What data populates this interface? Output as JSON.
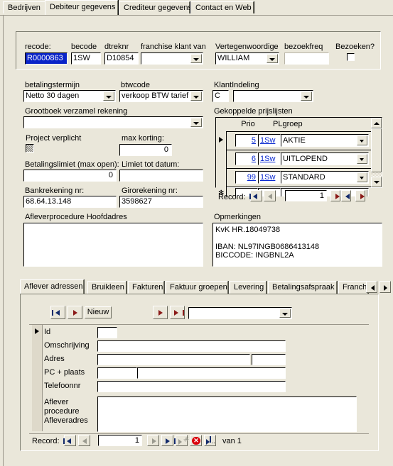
{
  "window": {
    "title": "Debiteur gegevens",
    "main_tabs": [
      {
        "label": "Bedrijven",
        "active": false
      },
      {
        "label": "Debiteur gegevens",
        "active": true
      },
      {
        "label": "Crediteur gegevens",
        "active": false
      },
      {
        "label": "Contact en Web",
        "active": false
      }
    ]
  },
  "header_fields": {
    "recode_label": "recode:",
    "recode_value": "R0000863",
    "becode_label": "becode",
    "becode_value": "1SW",
    "dtreknr_label": "dtreknr",
    "dtreknr_value": "D10854",
    "franchise_label": "franchise klant van",
    "franchise_value": "",
    "vertegenwoordige_label": "Vertegenwoordige",
    "vertegenwoordige_value": "WILLIAM",
    "bezoekfreq_label": "bezoekfreq",
    "bezoekfreq_value": "",
    "bezoeken_label": "Bezoeken?",
    "bezoeken_checked": false
  },
  "left_column": {
    "betalingstermijn_label": "betalingstermijn",
    "betalingstermijn_value": "Netto 30 dagen",
    "btwcode_label": "btwcode",
    "btwcode_value": "verkoop BTW tarief",
    "grootboek_label": "Grootboek verzamel rekening",
    "grootboek_value": "",
    "project_verplicht_label": "Project verplicht",
    "max_korting_label": "max korting:",
    "max_korting_value": "0",
    "betalingslimiet_label": "Betalingslimiet (max open):",
    "betalingslimiet_value": "0",
    "limiet_tot_datum_label": "Limiet tot datum:",
    "limiet_tot_datum_value": "",
    "bankrekening_label": "Bankrekening nr:",
    "bankrekening_value": "68.64.13.148",
    "girorekening_label": "Girorekening nr:",
    "girorekening_value": "3598627",
    "afleverprocedure_label": "Afleverprocedure Hoofdadres",
    "afleverprocedure_value": ""
  },
  "right_column": {
    "klantindeling_label": "KlantIndeling",
    "klantindeling_code": "C",
    "klantindeling_value": "",
    "prijslijsten_label": "Gekoppelde prijslijsten",
    "opmerkingen_label": "Opmerkingen",
    "opmerkingen_value": "KvK HR.18049738\n\nIBAN: NL97INGB0686413148\nBICCODE: INGBNL2A"
  },
  "prijslijsten_grid": {
    "columns": [
      "Prio",
      "PLgroep"
    ],
    "rows": [
      {
        "prio": "5",
        "code": "1Sw",
        "plgroep": "AKTIE",
        "selected": true
      },
      {
        "prio": "6",
        "code": "1Sw",
        "plgroep": "UITLOPEND",
        "selected": false
      },
      {
        "prio": "99",
        "code": "1Sw",
        "plgroep": "STANDARD",
        "selected": false
      }
    ],
    "nav": {
      "record_label": "Record:",
      "current": "1"
    }
  },
  "sub_tabs": [
    {
      "label": "Aflever adressen",
      "active": true
    },
    {
      "label": "Bruikleen",
      "active": false
    },
    {
      "label": "Fakturen",
      "active": false
    },
    {
      "label": "Faktuur groepen",
      "active": false
    },
    {
      "label": "Levering",
      "active": false
    },
    {
      "label": "Betalingsafspraak",
      "active": false
    },
    {
      "label": "Franchis",
      "active": false
    }
  ],
  "subform": {
    "toolbar": {
      "new_label": "Nieuw",
      "selector_value": ""
    },
    "fields": [
      {
        "label": "Id",
        "value": ""
      },
      {
        "label": "Omschrijving",
        "value": ""
      },
      {
        "label": "Adres",
        "value": "",
        "value2": ""
      },
      {
        "label": "PC + plaats",
        "value": "",
        "value2": ""
      },
      {
        "label": "Telefoonnr",
        "value": ""
      }
    ],
    "memo_label": "Aflever\nprocedure\nAfleveradres",
    "memo_value": "",
    "nav": {
      "record_label": "Record:",
      "current": "1",
      "of_label": "van  1"
    }
  },
  "colors": {
    "face": "#eae7da",
    "selection": "#0a24c8",
    "link": "#0b2ad0",
    "delete": "#d9000b",
    "nav_blue": "#132a6b",
    "nav_red": "#8b1a18"
  },
  "icons": {
    "first": "first-record-icon",
    "prev": "previous-record-icon",
    "next": "next-record-icon",
    "last": "last-record-icon",
    "new": "new-record-icon",
    "delete": "delete-record-icon",
    "filter": "filter-icon",
    "dropdown": "chevron-down-icon",
    "scroll_up": "scroll-up-icon",
    "scroll_down": "scroll-down-icon"
  }
}
